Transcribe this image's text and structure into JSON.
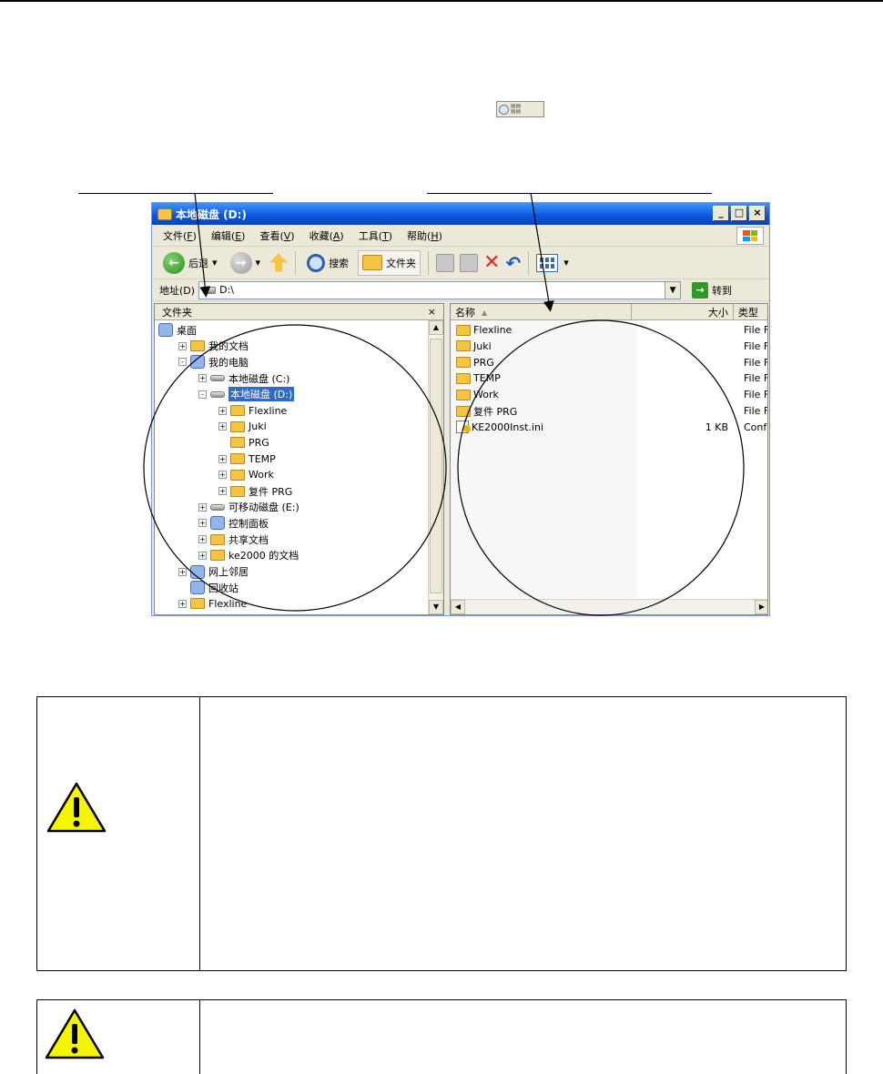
{
  "window": {
    "title": "本地磁盘 (D:)",
    "controls": [
      "_",
      "□",
      "×"
    ]
  },
  "menu": [
    {
      "label": "文件(",
      "key": "F",
      "tail": ")"
    },
    {
      "label": "编辑(",
      "key": "E",
      "tail": ")"
    },
    {
      "label": "查看(",
      "key": "V",
      "tail": ")"
    },
    {
      "label": "收藏(",
      "key": "A",
      "tail": ")"
    },
    {
      "label": "工具(",
      "key": "T",
      "tail": ")"
    },
    {
      "label": "帮助(",
      "key": "H",
      "tail": ")"
    }
  ],
  "toolbar": {
    "back": "后退",
    "search": "搜索",
    "folders": "文件夹"
  },
  "address": {
    "label": "地址(D)",
    "value": "D:\\",
    "go": "转到"
  },
  "folder_pane": {
    "title": "文件夹",
    "close": "×",
    "tree": [
      {
        "label": "桌面",
        "level": 0,
        "icon": "desktop-icon",
        "expander": "none"
      },
      {
        "label": "我的文档",
        "level": 1,
        "icon": "folder-icon",
        "expander": "+"
      },
      {
        "label": "我的电脑",
        "level": 1,
        "icon": "computer-icon",
        "expander": "-"
      },
      {
        "label": "本地磁盘 (C:)",
        "level": 2,
        "icon": "drive-icon",
        "expander": "+"
      },
      {
        "label": "本地磁盘 (D:)",
        "level": 2,
        "icon": "drive-icon",
        "expander": "-",
        "selected": true
      },
      {
        "label": "Flexline",
        "level": 3,
        "icon": "folder-icon",
        "expander": "+"
      },
      {
        "label": "Juki",
        "level": 3,
        "icon": "folder-icon",
        "expander": "+"
      },
      {
        "label": "PRG",
        "level": 3,
        "icon": "folder-icon",
        "expander": "none"
      },
      {
        "label": "TEMP",
        "level": 3,
        "icon": "folder-icon",
        "expander": "+"
      },
      {
        "label": "Work",
        "level": 3,
        "icon": "folder-icon",
        "expander": "+"
      },
      {
        "label": "复件 PRG",
        "level": 3,
        "icon": "folder-icon",
        "expander": "+"
      },
      {
        "label": "可移动磁盘 (E:)",
        "level": 2,
        "icon": "drive-icon",
        "expander": "+"
      },
      {
        "label": "控制面板",
        "level": 2,
        "icon": "control-panel-icon",
        "expander": "+"
      },
      {
        "label": "共享文档",
        "level": 2,
        "icon": "folder-icon",
        "expander": "+"
      },
      {
        "label": "ke2000 的文档",
        "level": 2,
        "icon": "folder-icon",
        "expander": "+"
      },
      {
        "label": "网上邻居",
        "level": 1,
        "icon": "network-icon",
        "expander": "+"
      },
      {
        "label": "回收站",
        "level": 1,
        "icon": "recycle-bin-icon",
        "expander": "none"
      },
      {
        "label": "Flexline",
        "level": 1,
        "icon": "folder-icon",
        "expander": "+"
      }
    ]
  },
  "file_pane": {
    "columns": {
      "name": "名称",
      "size": "大小",
      "type": "类型"
    },
    "rows": [
      {
        "name": "Flexline",
        "size": "",
        "type": "File F",
        "icon": "folder-icon"
      },
      {
        "name": "Juki",
        "size": "",
        "type": "File F",
        "icon": "folder-icon"
      },
      {
        "name": "PRG",
        "size": "",
        "type": "File F",
        "icon": "folder-icon"
      },
      {
        "name": "TEMP",
        "size": "",
        "type": "File F",
        "icon": "folder-icon"
      },
      {
        "name": "Work",
        "size": "",
        "type": "File F",
        "icon": "folder-icon"
      },
      {
        "name": "复件 PRG",
        "size": "",
        "type": "File F",
        "icon": "folder-icon"
      },
      {
        "name": "KE2000Inst.ini",
        "size": "1 KB",
        "type": "Conf",
        "icon": "ini-file-icon"
      }
    ]
  },
  "colors": {
    "titlebar": "#0a55dd",
    "selection": "#316ac5",
    "warning_fill": "#f5f500"
  }
}
